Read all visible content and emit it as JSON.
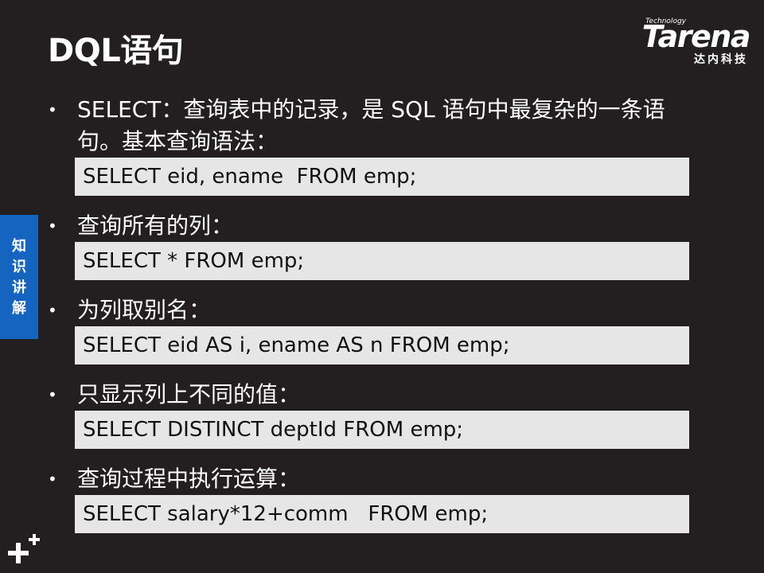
{
  "slide": {
    "title": "DQL语句",
    "side_tab": [
      "知",
      "识",
      "讲",
      "解"
    ]
  },
  "logo": {
    "tagline": "Technology",
    "brand": "Tarena",
    "subtitle": "达内科技"
  },
  "items": [
    {
      "bullet": "•",
      "text": "SELECT：查询表中的记录，是 SQL 语句中最复杂的一条语句。基本查询语法：",
      "code": "SELECT eid, ename  FROM emp;"
    },
    {
      "bullet": "•",
      "text": "查询所有的列：",
      "code": "SELECT * FROM emp;"
    },
    {
      "bullet": "•",
      "text": "为列取别名：",
      "code": "SELECT eid AS i, ename AS n FROM emp;"
    },
    {
      "bullet": "•",
      "text": "只显示列上不同的值：",
      "code": "SELECT DISTINCT deptId FROM emp;"
    },
    {
      "bullet": "•",
      "text": "查询过程中执行运算：",
      "code": "SELECT salary*12+comm   FROM emp;"
    }
  ],
  "colors": {
    "background": "#231f20",
    "side_tab": "#1565c0",
    "code_box": "#e6e6e6",
    "text": "#ffffff"
  },
  "icons": {
    "corner_mark": "plus-plus-icon"
  }
}
